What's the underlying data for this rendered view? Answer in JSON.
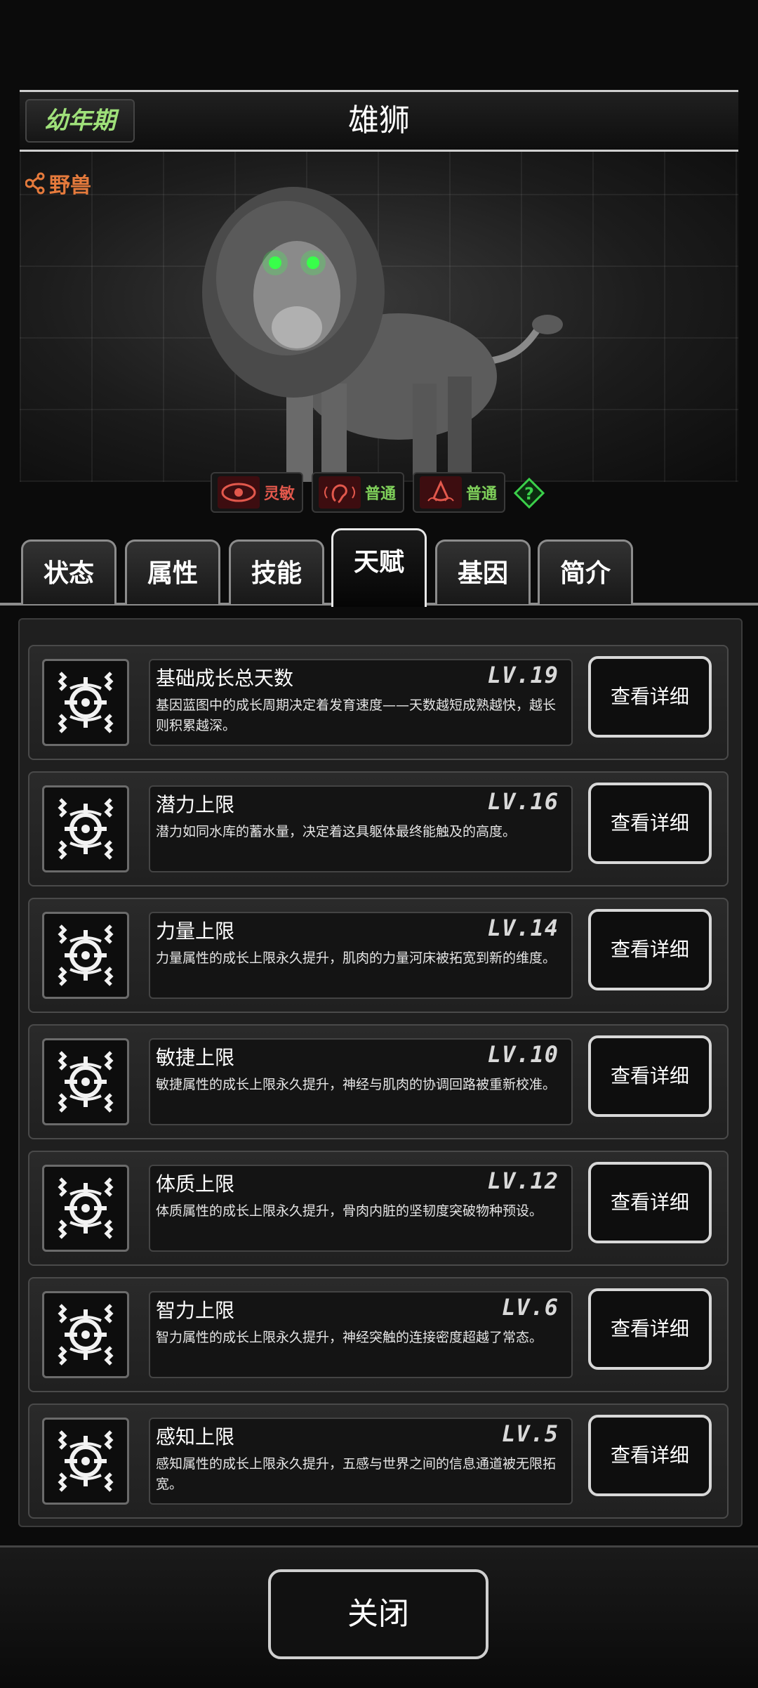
{
  "header": {
    "stage": "幼年期",
    "title": "雄狮"
  },
  "picture": {
    "share_label": "野兽"
  },
  "traits": [
    {
      "icon": "eye-icon",
      "label": "灵敏",
      "color": "#e2584c"
    },
    {
      "icon": "ear-icon",
      "label": "普通",
      "color": "#7fd05a"
    },
    {
      "icon": "nose-icon",
      "label": "普通",
      "color": "#7fd05a"
    }
  ],
  "tabs": [
    "状态",
    "属性",
    "技能",
    "天赋",
    "基因",
    "简介"
  ],
  "active_tab": "天赋",
  "talents": [
    {
      "name": "基础成长总天数",
      "level": "LV.19",
      "desc": "基因蓝图中的成长周期决定着发育速度——天数越短成熟越快，越长则积累越深。",
      "button": "查看详细"
    },
    {
      "name": "潜力上限",
      "level": "LV.16",
      "desc": "潜力如同水库的蓄水量，决定着这具躯体最终能触及的高度。",
      "button": "查看详细"
    },
    {
      "name": "力量上限",
      "level": "LV.14",
      "desc": "力量属性的成长上限永久提升，肌肉的力量河床被拓宽到新的维度。",
      "button": "查看详细"
    },
    {
      "name": "敏捷上限",
      "level": "LV.10",
      "desc": "敏捷属性的成长上限永久提升，神经与肌肉的协调回路被重新校准。",
      "button": "查看详细"
    },
    {
      "name": "体质上限",
      "level": "LV.12",
      "desc": "体质属性的成长上限永久提升，骨肉内脏的坚韧度突破物种预设。",
      "button": "查看详细"
    },
    {
      "name": "智力上限",
      "level": "LV.6",
      "desc": "智力属性的成长上限永久提升，神经突触的连接密度超越了常态。",
      "button": "查看详细"
    },
    {
      "name": "感知上限",
      "level": "LV.5",
      "desc": "感知属性的成长上限永久提升，五感与世界之间的信息通道被无限拓宽。",
      "button": "查看详细"
    }
  ],
  "footer": {
    "close_label": "关闭"
  },
  "colors": {
    "stage": "#9fe07a",
    "share": "#e57a3c",
    "lion_eyes": "#38ff4a"
  }
}
